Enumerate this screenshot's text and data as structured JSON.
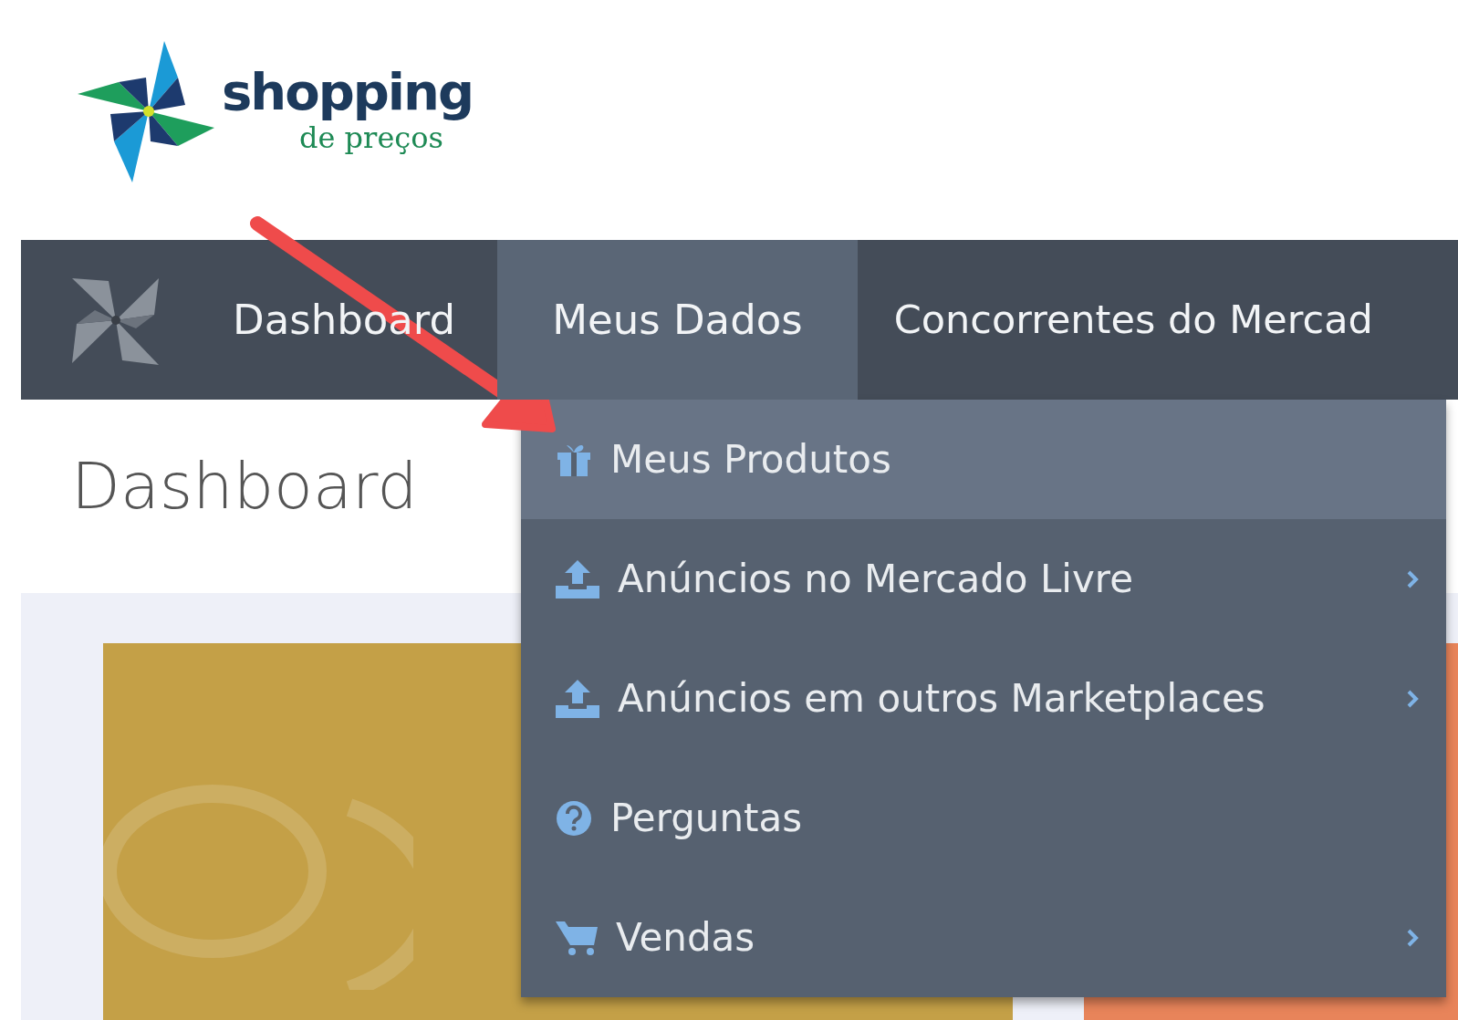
{
  "logo": {
    "name": "shopping",
    "tagline": "de preços"
  },
  "nav": [
    {
      "label": "Dashboard",
      "selected": false
    },
    {
      "label": "Meus Dados",
      "selected": true
    },
    {
      "label": "Concorrentes do Mercad",
      "selected": false
    }
  ],
  "dropdown": [
    {
      "label": "Meus Produtos",
      "kind": "gift",
      "submenu": false,
      "selected": true
    },
    {
      "label": "Anúncios no Mercado Livre",
      "kind": "upload",
      "submenu": true,
      "selected": false
    },
    {
      "label": "Anúncios em outros Marketplaces",
      "kind": "upload",
      "submenu": true,
      "selected": false
    },
    {
      "label": "Perguntas",
      "kind": "question",
      "submenu": false,
      "selected": false
    },
    {
      "label": "Vendas",
      "kind": "cart",
      "submenu": true,
      "selected": false
    }
  ],
  "page_title": "Dashboard",
  "cards": [
    {
      "color": "#c4a047"
    },
    {
      "color": "#e8845a"
    }
  ]
}
